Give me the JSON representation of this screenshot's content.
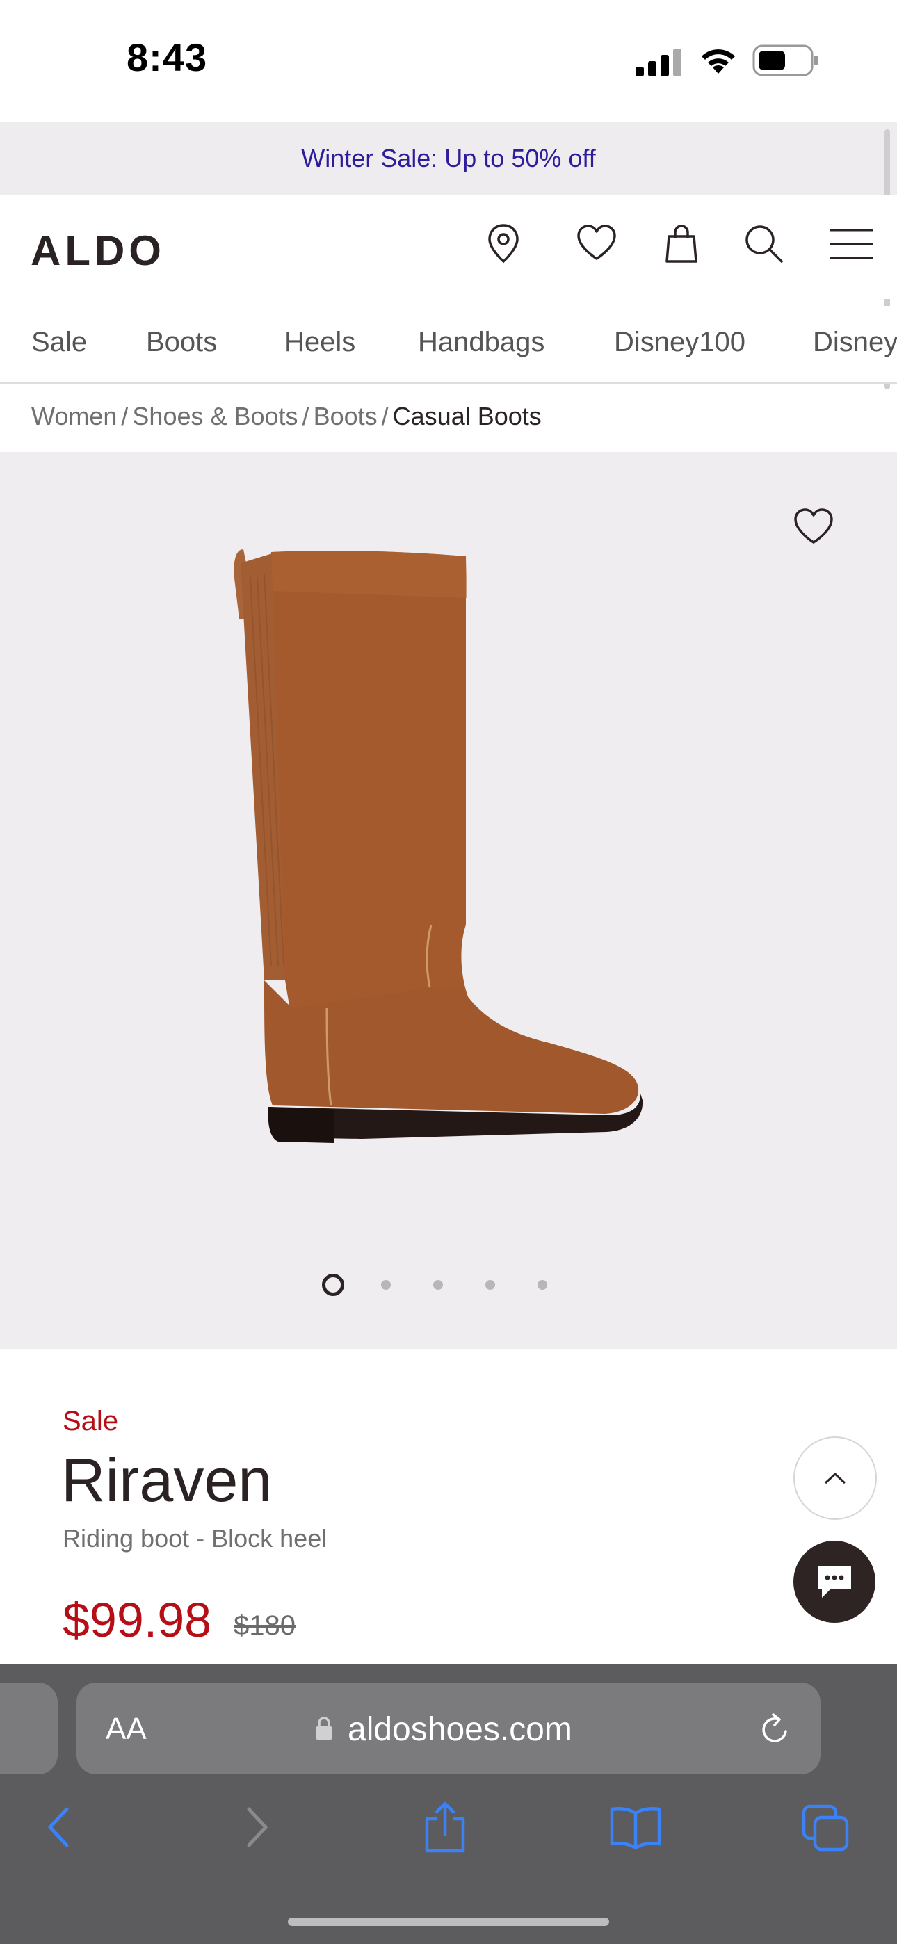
{
  "status_bar": {
    "time": "8:43"
  },
  "promo": {
    "text": "Winter Sale: Up to 50% off"
  },
  "header": {
    "logo": "ALDO",
    "icons": [
      "location-pin-icon",
      "heart-icon",
      "shopping-bag-icon",
      "search-icon",
      "menu-icon"
    ]
  },
  "nav": {
    "items": [
      {
        "label": "Sale"
      },
      {
        "label": "Boots"
      },
      {
        "label": "Heels"
      },
      {
        "label": "Handbags"
      },
      {
        "label": "Disney100"
      },
      {
        "label": "Disney"
      }
    ]
  },
  "breadcrumb": {
    "items": [
      "Women",
      "Shoes & Boots",
      "Boots"
    ],
    "current": "Casual Boots"
  },
  "gallery": {
    "image_count": 5,
    "active_index": 0
  },
  "product": {
    "badge": "Sale",
    "name": "Riraven",
    "subtitle": "Riding boot - Block heel",
    "price": "$99.98",
    "original_price": "$180"
  },
  "browser": {
    "text_size_label": "AA",
    "url": "aldoshoes.com"
  },
  "colors": {
    "sale_red": "#b50e16",
    "promo_text": "#2e1d9a",
    "brand_dark": "#2b2323",
    "safari_blue": "#3b82f6"
  }
}
